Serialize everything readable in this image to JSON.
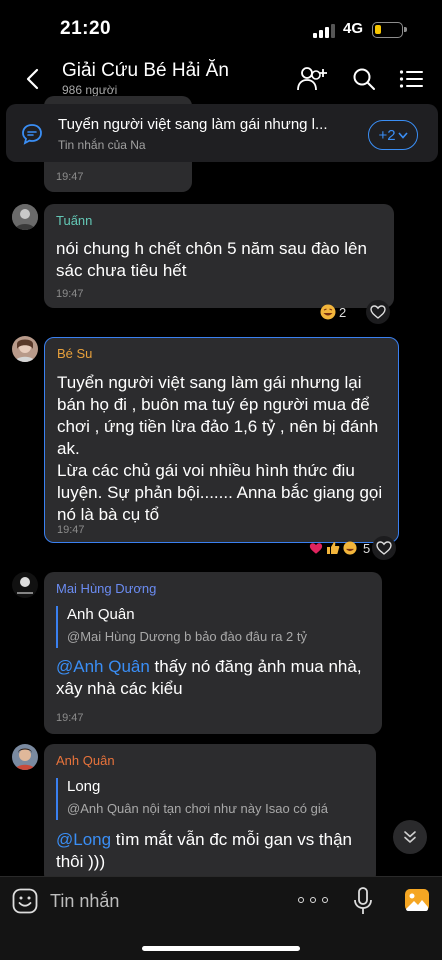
{
  "status_bar": {
    "time": "21:20",
    "network": "4G",
    "battery_color": "#f7c600"
  },
  "header": {
    "title": "Giải Cứu Bé Hải Ăn",
    "member_count": "986 người"
  },
  "pinned": {
    "text": "Tuyển  người việt sang làm gái nhưng l...",
    "source": "Tin nhắn của Na",
    "more_count": "+2"
  },
  "partial_top": {
    "time": "19:47"
  },
  "messages": [
    {
      "sender": "Tuấnn",
      "sender_color": "#63c7b5",
      "lines": [
        "nói chung h chết chôn 5 năm sau đào lên",
        "sác chưa tiêu hết"
      ],
      "time": "19:47",
      "reaction_count": "2"
    },
    {
      "sender": "Bé Su",
      "sender_color": "#e8a13b",
      "lines": [
        "Tuyển  người việt sang làm gái nhưng lại",
        "bán họ đi , buôn ma tuý ép người mua để",
        "chơi , ứng tiền lừa đảo 1,6 tỷ , nên bị đánh",
        "ak.",
        "Lừa các chủ gái voi nhiều hình thức điu",
        "luyện. Sự phản bội....... Anna bắc giang gọi",
        "nó là bà cụ tổ"
      ],
      "time": "19:47",
      "reaction_count": "5"
    },
    {
      "sender": "Mai Hùng Dương",
      "sender_color": "#6b8cf2",
      "quote_name": "Anh Quân",
      "quote_text": "@Mai Hùng Dương b bảo đào đâu ra 2 tỷ",
      "mention": "@Anh Quân",
      "line1_rest": " thấy nó đăng ảnh mua nhà,",
      "line2": "xây nhà các kiểu",
      "time": "19:47"
    },
    {
      "sender": "Anh Quân",
      "sender_color": "#e8733b",
      "quote_name": "Long",
      "quote_text": "@Anh Quân nội tạn chơi như này Isao có giá",
      "mention": "@Long",
      "line1_rest": " tìm mắt vẫn đc mỗi gan vs thận",
      "line2": "thôi )))"
    }
  ],
  "composer": {
    "placeholder": "Tin nhắn"
  },
  "colors": {
    "accent": "#3a8ef5",
    "bubble": "#2c2c2e",
    "background": "#000000",
    "heart": "#e0245e",
    "gallery": "#f5a623"
  }
}
